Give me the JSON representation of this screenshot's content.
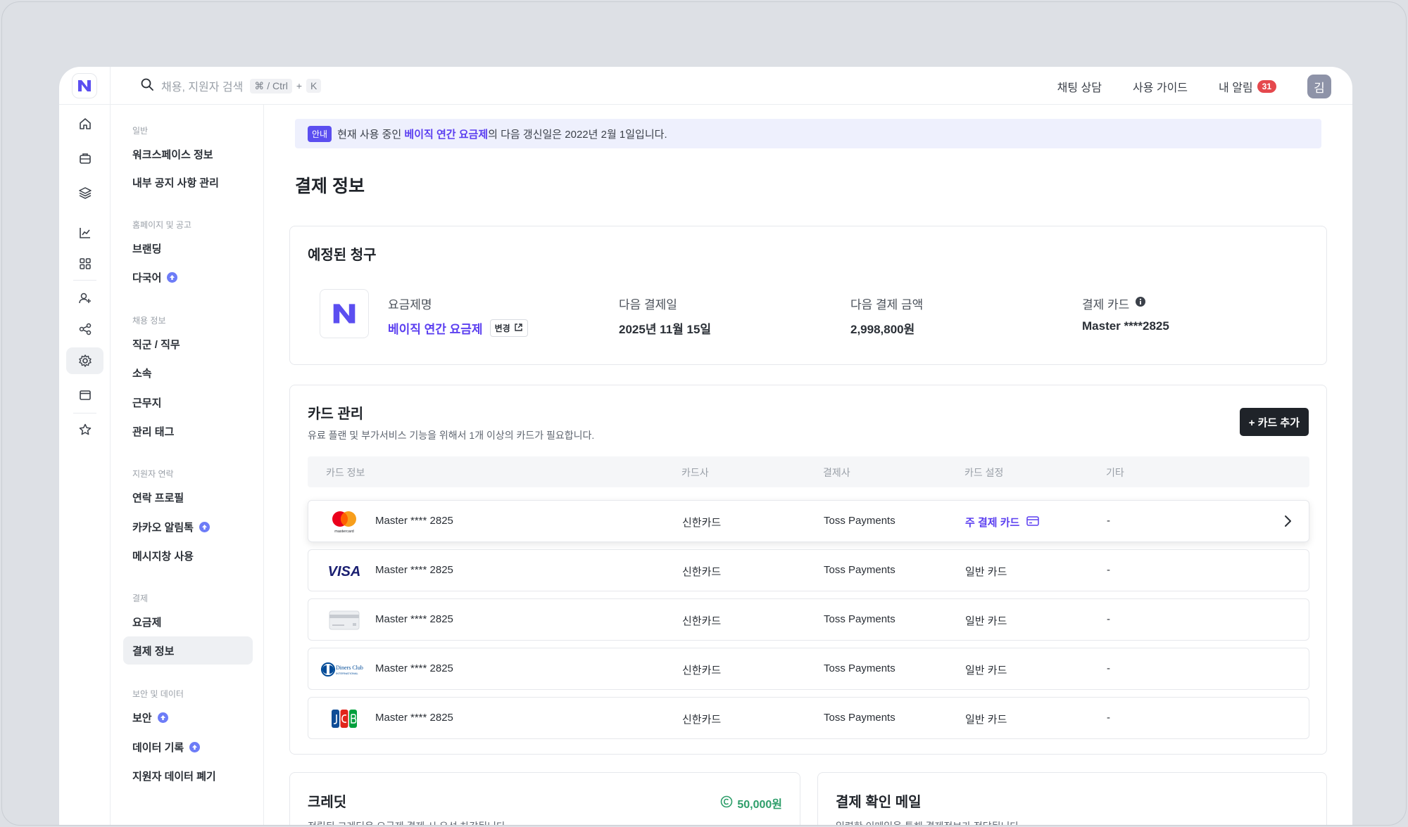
{
  "search": {
    "placeholder": "채용, 지원자 검색",
    "shortcut_keys": "⌘ / Ctrl",
    "shortcut_plus": "+",
    "shortcut_k": "K"
  },
  "header": {
    "chat": "채팅 상담",
    "guide": "사용 가이드",
    "notifications": "내 알림",
    "notification_count": "31",
    "avatar": "김"
  },
  "sidebar": {
    "groups": [
      {
        "title": "일반",
        "items": [
          "워크스페이스 정보",
          "내부 공지 사항 관리"
        ]
      },
      {
        "title": "홈페이지 및 공고",
        "items": [
          "브랜딩",
          "다국어"
        ]
      },
      {
        "title": "채용 정보",
        "items": [
          "직군 / 직무",
          "소속",
          "근무지",
          "관리 태그"
        ]
      },
      {
        "title": "지원자 연락",
        "items": [
          "연락 프로필",
          "카카오 알림톡",
          "메시지창 사용"
        ]
      },
      {
        "title": "결제",
        "items": [
          "요금제",
          "결제 정보"
        ]
      },
      {
        "title": "보안 및 데이터",
        "items": [
          "보안",
          "데이터 기록",
          "지원자 데이터 폐기"
        ]
      }
    ],
    "active": "결제 정보"
  },
  "notice": {
    "tag": "안내",
    "prefix": "현재 사용 중인 ",
    "plan": "베이직 연간 요금제",
    "suffix": "의 다음 갱신일은 2022년 2월 1일입니다."
  },
  "page_title": "결제 정보",
  "billing": {
    "title": "예정된 청구",
    "plan_label": "요금제명",
    "plan_value": "베이직 연간 요금제",
    "change": "변경",
    "next_date_label": "다음 결제일",
    "next_date_value": "2025년 11월 15일",
    "next_amount_label": "다음 결제 금액",
    "next_amount_value": "2,998,800원",
    "card_label": "결제 카드",
    "card_value": "Master ****2825"
  },
  "cards": {
    "title": "카드 관리",
    "subtitle": "유료 플랜 및 부가서비스 기능을 위해서 1개 이상의 카드가 필요합니다.",
    "add_button": "+ 카드 추가",
    "columns": [
      "카드 정보",
      "카드사",
      "결제사",
      "카드 설정",
      "기타"
    ],
    "rows": [
      {
        "brand": "mastercard-icon",
        "name": "Master **** 2825",
        "issuer": "신한카드",
        "processor": "Toss Payments",
        "setting": "주 결제 카드",
        "etc": "-"
      },
      {
        "brand": "visa-icon",
        "name": "Master **** 2825",
        "issuer": "신한카드",
        "processor": "Toss Payments",
        "setting": "일반 카드",
        "etc": "-"
      },
      {
        "brand": "generic-card-icon",
        "name": "Master **** 2825",
        "issuer": "신한카드",
        "processor": "Toss Payments",
        "setting": "일반 카드",
        "etc": "-"
      },
      {
        "brand": "diners-club-icon",
        "name": "Master **** 2825",
        "issuer": "신한카드",
        "processor": "Toss Payments",
        "setting": "일반 카드",
        "etc": "-"
      },
      {
        "brand": "jcb-icon",
        "name": "Master **** 2825",
        "issuer": "신한카드",
        "processor": "Toss Payments",
        "setting": "일반 카드",
        "etc": "-"
      }
    ],
    "visa_text": "VISA",
    "diners_text": "Diners Club",
    "diners_sub": "INTERNATIONAL",
    "mastercard_text": "mastercard"
  },
  "credit": {
    "title": "크레딧",
    "amount": "50,000원",
    "subtitle": "적립된 크레딧은 요금제 결제 시 우선 차감됩니다."
  },
  "email": {
    "title": "결제 확인 메일",
    "subtitle": "입력한 이메일을 통해 결제정보가 전달됩니다."
  },
  "colors": {
    "accent": "#5b3ff0",
    "badge": "#e5484d",
    "credit": "#2e9e6a",
    "dark_button": "#1f2329"
  }
}
